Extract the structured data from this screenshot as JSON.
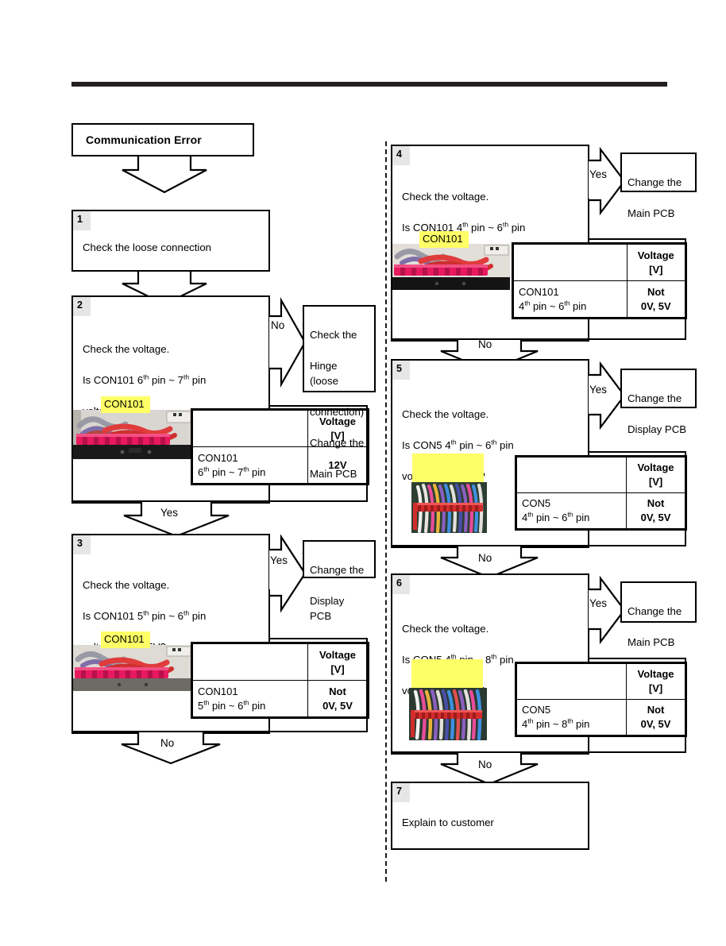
{
  "document": {
    "type": "troubleshooting-flowchart",
    "title": "Communication Error"
  },
  "left_column": {
    "title_box": {
      "label": "Communication Error"
    },
    "steps": [
      {
        "number": "1",
        "text": "Check the loose connection"
      },
      {
        "number": "2",
        "text": "Check the voltage.\nIs CON101 6th pin ~ 7th pin\nvoltage 12V?",
        "text_lines": [
          "Check the voltage.",
          "Is CON101 6th pin ~ 7th pin",
          "voltage 12V?"
        ],
        "photo_label": "CON101",
        "table": {
          "header_blank": "",
          "header_voltage": "Voltage\n[V]",
          "row_label": "CON101\n6th pin ~ 7th pin",
          "row_value": "12V"
        },
        "branch_yes_label": "Yes",
        "branch_no_label": "No",
        "branch_target": "Check the\nHinge (loose\nconnection)\nChange the\nMain PCB"
      },
      {
        "number": "3",
        "text": "Check the voltage.\nIs CON101 5th pin ~ 6th pin\nvoltage 0V or 5V?",
        "photo_label": "CON101",
        "table": {
          "header_voltage": "Voltage\n[V]",
          "row_label": "CON101\n5th pin ~ 6th pin",
          "row_value": "Not\n0V, 5V"
        },
        "branch_yes_label": "Yes",
        "branch_no_label": "No",
        "branch_target": "Change the\nDisplay PCB"
      }
    ]
  },
  "right_column": {
    "steps": [
      {
        "number": "4",
        "text": "Check the voltage.\nIs CON101 4th pin ~ 6th pin\nvoltage 0V or 5V?",
        "photo_label": "CON101",
        "table": {
          "header_voltage": "Voltage\n[V]",
          "row_label": "CON101\n4th pin ~ 6th pin",
          "row_value": "Not\n0V, 5V"
        },
        "branch_yes_label": "Yes",
        "branch_no_label": "No",
        "branch_target": "Change the\nMain PCB"
      },
      {
        "number": "5",
        "text": "Check the voltage.\nIs CON5 4th pin ~ 6th pin\nvoltage 0V or 5V?",
        "photo_label": "",
        "table": {
          "header_voltage": "Voltage\n[V]",
          "row_label": "CON5\n4th pin ~ 6th pin",
          "row_value": "Not\n0V, 5V"
        },
        "branch_yes_label": "Yes",
        "branch_no_label": "No",
        "branch_target": "Change the\nDisplay PCB"
      },
      {
        "number": "6",
        "text": "Check the voltage.\nIs CON5 4th pin ~ 8th pin\nvoltage 0V or 5V?",
        "photo_label": "",
        "table": {
          "header_voltage": "Voltage\n[V]",
          "row_label": "CON5\n4th pin ~ 8th pin",
          "row_value": "Not\n0V, 5V"
        },
        "branch_yes_label": "Yes",
        "branch_no_label": "No",
        "branch_target": "Change the\nMain PCB"
      },
      {
        "number": "7",
        "text": "Explain to customer"
      }
    ]
  },
  "labels": {
    "yes": "Yes",
    "no": "No",
    "voltage_header": "Voltage",
    "voltage_unit": "[V]",
    "not": "Not",
    "zero_five": "0V, 5V",
    "twelve": "12V",
    "con101": "CON101",
    "con5": "CON5"
  },
  "text_fragments": {
    "s2_l1": "Check the voltage.",
    "s2_l2_a": "Is CON101 6",
    "s2_l2_sup1": "th",
    "s2_l2_b": " pin ~ 7",
    "s2_l2_sup2": "th",
    "s2_l2_c": " pin",
    "s2_l3": "voltage 12V?",
    "s3_l2_a": "Is CON101 5",
    "s3_l2_b": " pin ~ 6",
    "s3_l2_c": " pin",
    "s3_l3": "voltage 0V or 5V?",
    "s4_l2_a": "Is CON101 4",
    "s4_l2_b": " pin ~ 6",
    "s5_l2_a": "Is CON5 4",
    "s5_l2_b": " pin ~ 6",
    "s6_l2_a": "Is CON5 4",
    "s6_l2_b": " pin ~ 8",
    "step1_text": "Check the loose connection",
    "step7_text": "Explain to customer",
    "hinge_l1": "Check the",
    "hinge_l2": "Hinge (loose",
    "hinge_l3": "connection)",
    "hinge_l4": "Change the",
    "hinge_l5": "Main PCB",
    "disp_l1": "Change the",
    "disp_l2": "Display PCB",
    "main_l1": "Change the",
    "main_l2": "Main PCB",
    "pin_th": "th",
    "pin_word": " pin",
    "tbl_con101": "CON101",
    "tbl_con5": "CON5",
    "tbl_67": "6",
    "tbl_56": "5",
    "tbl_46": "4",
    "tbl_48": "4"
  },
  "colors": {
    "rule": "#231f20",
    "box_border": "#000000",
    "step_badge_bg": "#e6e6e6",
    "highlight_yellow": "#ffff66",
    "background": "#ffffff"
  }
}
